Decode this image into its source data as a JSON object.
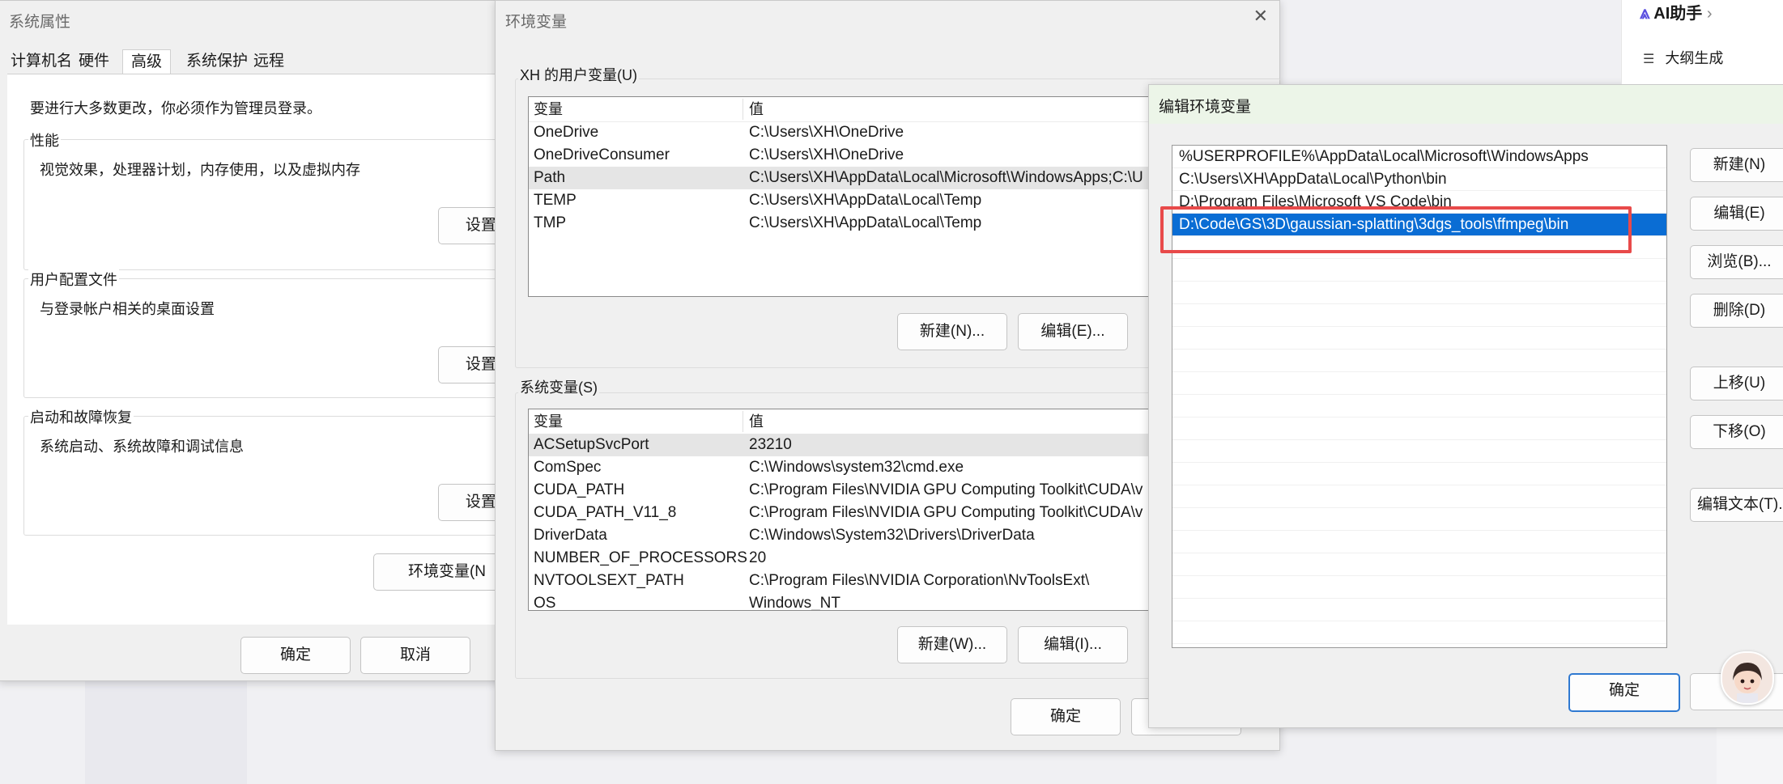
{
  "sys_props": {
    "title": "系统属性",
    "tabs": [
      "计算机名",
      "硬件",
      "高级",
      "系统保护",
      "远程"
    ],
    "admin_note": "要进行大多数更改，你必须作为管理员登录。",
    "performance": {
      "label": "性能",
      "desc": "视觉效果，处理器计划，内存使用，以及虚拟内存",
      "button": "设置("
    },
    "profiles": {
      "label": "用户配置文件",
      "desc": "与登录帐户相关的桌面设置",
      "button": "设置("
    },
    "startup": {
      "label": "启动和故障恢复",
      "desc": "系统启动、系统故障和调试信息",
      "button": "设置("
    },
    "env_button": "环境变量(N",
    "ok": "确定",
    "cancel": "取消"
  },
  "env_vars": {
    "title": "环境变量",
    "close_glyph": "✕",
    "user_group_label": "XH 的用户变量(U)",
    "col_var": "变量",
    "col_val": "值",
    "user_rows": [
      {
        "name": "OneDrive",
        "value": "C:\\Users\\XH\\OneDrive"
      },
      {
        "name": "OneDriveConsumer",
        "value": "C:\\Users\\XH\\OneDrive"
      },
      {
        "name": "Path",
        "value": "C:\\Users\\XH\\AppData\\Local\\Microsoft\\WindowsApps;C:\\U"
      },
      {
        "name": "TEMP",
        "value": "C:\\Users\\XH\\AppData\\Local\\Temp"
      },
      {
        "name": "TMP",
        "value": "C:\\Users\\XH\\AppData\\Local\\Temp"
      }
    ],
    "user_new": "新建(N)...",
    "user_edit": "编辑(E)...",
    "sys_group_label": "系统变量(S)",
    "sys_rows": [
      {
        "name": "ACSetupSvcPort",
        "value": "23210"
      },
      {
        "name": "ComSpec",
        "value": "C:\\Windows\\system32\\cmd.exe"
      },
      {
        "name": "CUDA_PATH",
        "value": "C:\\Program Files\\NVIDIA GPU Computing Toolkit\\CUDA\\v"
      },
      {
        "name": "CUDA_PATH_V11_8",
        "value": "C:\\Program Files\\NVIDIA GPU Computing Toolkit\\CUDA\\v"
      },
      {
        "name": "DriverData",
        "value": "C:\\Windows\\System32\\Drivers\\DriverData"
      },
      {
        "name": "NUMBER_OF_PROCESSORS",
        "value": "20"
      },
      {
        "name": "NVTOOLSEXT_PATH",
        "value": "C:\\Program Files\\NVIDIA Corporation\\NvToolsExt\\"
      },
      {
        "name": "OS",
        "value": "Windows_NT"
      }
    ],
    "sys_new": "新建(W)...",
    "sys_edit": "编辑(I)...",
    "ok": "确定"
  },
  "edit_env": {
    "title": "编辑环境变量",
    "entries": [
      "%USERPROFILE%\\AppData\\Local\\Microsoft\\WindowsApps",
      "C:\\Users\\XH\\AppData\\Local\\Python\\bin",
      "D:\\Program Files\\Microsoft VS Code\\bin",
      "D:\\Code\\GS\\3D\\gaussian-splatting\\3dgs_tools\\ffmpeg\\bin"
    ],
    "buttons": {
      "new": "新建(N)",
      "edit": "编辑(E)",
      "browse": "浏览(B)...",
      "delete": "删除(D)",
      "up": "上移(U)",
      "down": "下移(O)",
      "edit_text": "编辑文本(T)..."
    },
    "ok": "确定",
    "highlight_color": "#e84a4a",
    "selection_color": "#0a6dd4"
  },
  "ai_panel": {
    "title": "AI助手",
    "chevron": "›",
    "outline": "大纲生成"
  }
}
